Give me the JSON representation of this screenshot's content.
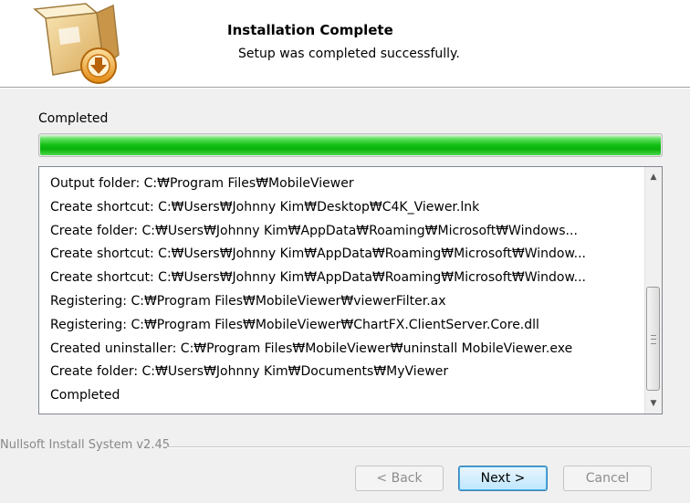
{
  "header": {
    "title": "Installation Complete",
    "subtitle": "Setup was completed successfully."
  },
  "progress": {
    "label": "Completed",
    "percent": 100,
    "color": "#13c013"
  },
  "log": {
    "lines": [
      "Output folder: C:₩Program Files₩MobileViewer",
      "Create shortcut: C:₩Users₩Johnny Kim₩Desktop₩C4K_Viewer.lnk",
      "Create folder: C:₩Users₩Johnny Kim₩AppData₩Roaming₩Microsoft₩Windows...",
      "Create shortcut: C:₩Users₩Johnny Kim₩AppData₩Roaming₩Microsoft₩Window...",
      "Create shortcut: C:₩Users₩Johnny Kim₩AppData₩Roaming₩Microsoft₩Window...",
      "Registering: C:₩Program Files₩MobileViewer₩viewerFilter.ax",
      "Registering: C:₩Program Files₩MobileViewer₩ChartFX.ClientServer.Core.dll",
      "Created uninstaller: C:₩Program Files₩MobileViewer₩uninstall MobileViewer.exe",
      "Create folder: C:₩Users₩Johnny Kim₩Documents₩MyViewer",
      "Completed"
    ],
    "scroll_up_glyph": "▲",
    "scroll_down_glyph": "▼"
  },
  "footer": {
    "branding": "Nullsoft Install System v2.45"
  },
  "buttons": {
    "back": "< Back",
    "next": "Next >",
    "cancel": "Cancel"
  },
  "icons": {
    "logo": "installer-box-icon"
  }
}
